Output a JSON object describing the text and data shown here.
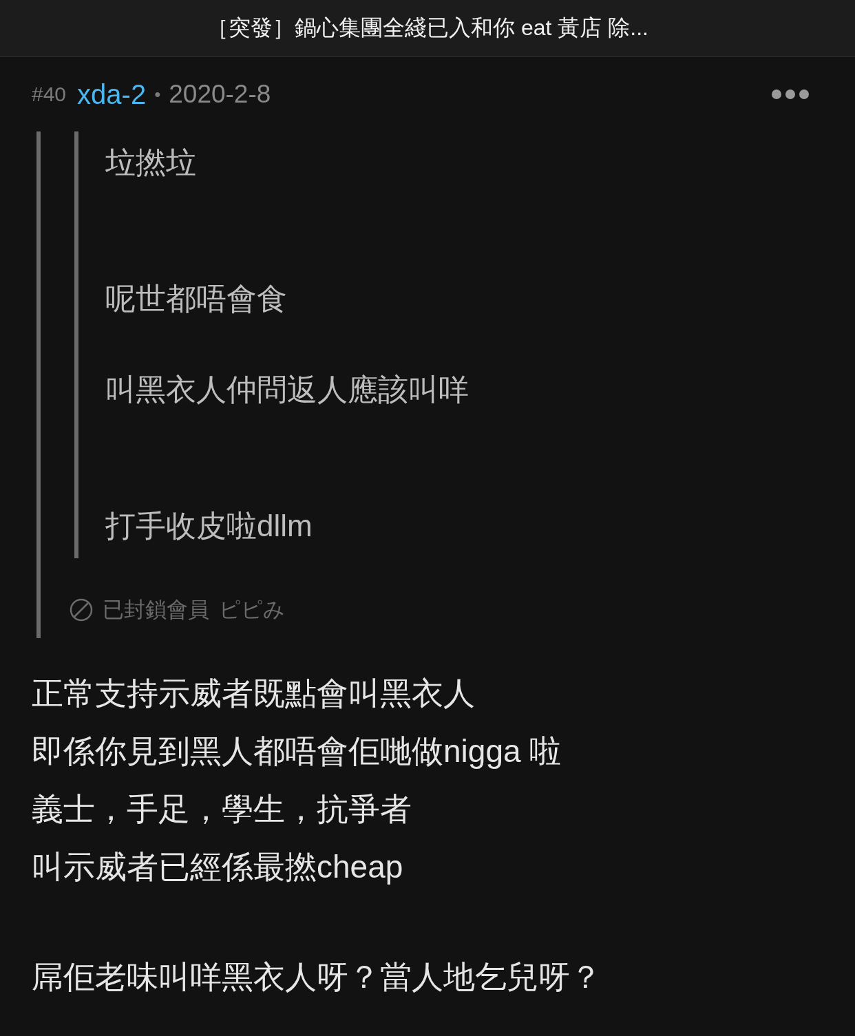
{
  "header": {
    "title": "［突發］鍋心集團全綫已入和你 eat 黃店 除..."
  },
  "post": {
    "floor": "#40",
    "username": "xda-2",
    "separator": "•",
    "date": "2020-2-8",
    "quote": {
      "nested_quote": {
        "lines": [
          "垃撚垃",
          "呢世都唔會食",
          "叫黑衣人仲問返人應該叫咩",
          "打手收皮啦dllm"
        ]
      },
      "blocked_notice": {
        "text": "已封鎖會員",
        "name": "ピピみ"
      }
    },
    "body": {
      "paragraphs": [
        {
          "lines": [
            "正常支持示威者既點會叫黑衣人",
            "即係你見到黑人都唔會佢哋做nigga 啦",
            "義士，手足，學生，抗爭者",
            "叫示威者已經係最撚cheap"
          ]
        },
        {
          "lines": [
            "屌佢老味叫咩黑衣人呀？當人地乞兒呀？"
          ]
        }
      ]
    }
  }
}
